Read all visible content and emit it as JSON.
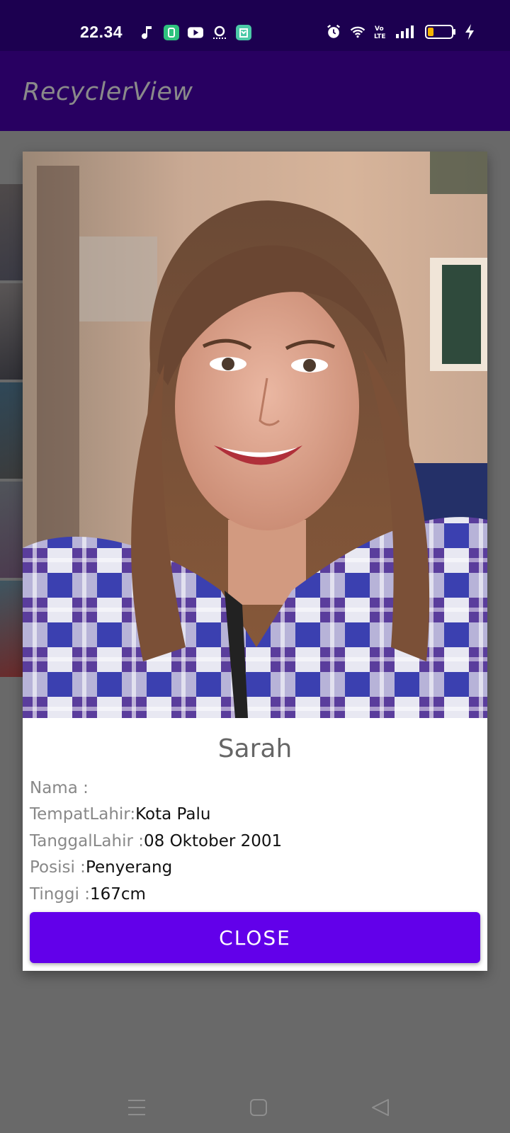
{
  "status_bar": {
    "time": "22.34",
    "left_icons": [
      "music-note-icon",
      "chat-app-icon",
      "youtube-icon",
      "camera-detect-icon",
      "store-app-icon"
    ],
    "right_icons": [
      "alarm-icon",
      "wifi-icon",
      "volte-icon",
      "signal-icon",
      "battery-icon",
      "charging-icon"
    ],
    "volte_label": "Vo\nLTE"
  },
  "app_bar": {
    "title": "RecyclerView"
  },
  "dialog": {
    "name": "Sarah",
    "fields": [
      {
        "label": "Nama : ",
        "value": ""
      },
      {
        "label": "TempatLahir:",
        "value": "Kota Palu"
      },
      {
        "label": "TanggalLahir : ",
        "value": "08 Oktober 2001"
      },
      {
        "label": "Posisi :",
        "value": "Penyerang"
      },
      {
        "label": "Tinggi :",
        "value": "167cm"
      }
    ],
    "close_label": "CLOSE"
  },
  "nav_bar": {
    "icons": [
      "menu-icon",
      "home-icon",
      "back-icon"
    ]
  },
  "colors": {
    "status_bar": "#1c0050",
    "app_bar": "#280061",
    "accent_button": "#6200ea",
    "scrim": "#696969"
  }
}
